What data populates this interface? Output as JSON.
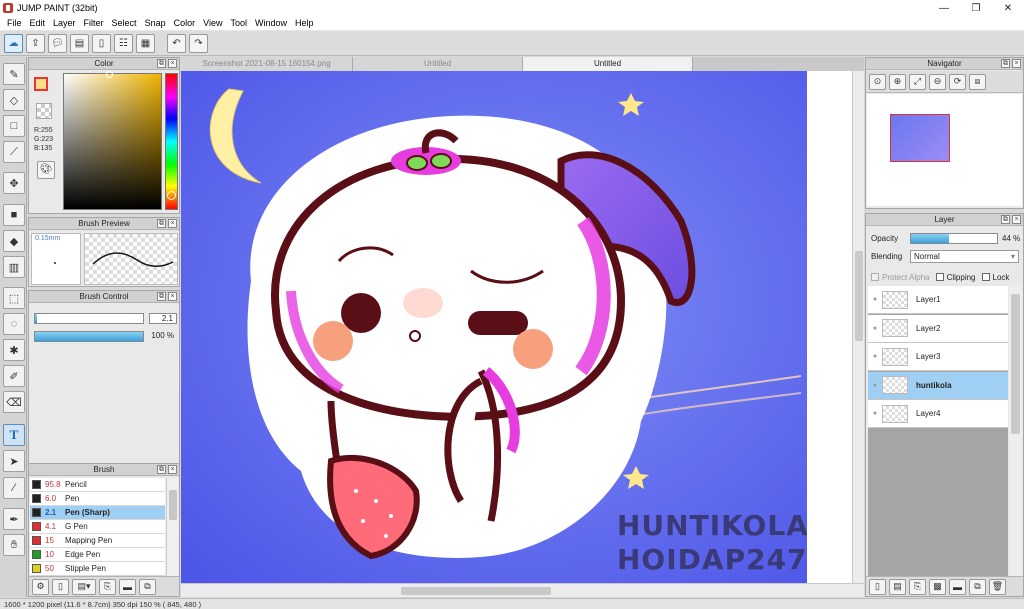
{
  "window": {
    "title": "JUMP PAINT (32bit)",
    "controls": [
      "—",
      "❐",
      "✕"
    ]
  },
  "menu": [
    "File",
    "Edit",
    "Layer",
    "Filter",
    "Select",
    "Snap",
    "Color",
    "View",
    "Tool",
    "Window",
    "Help"
  ],
  "toolbar": {
    "icons": [
      "cloud-upload-icon",
      "share-icon",
      "comment-icon",
      "chat-icon",
      "document-icon",
      "grid-list-icon",
      "template-icon",
      "undo-icon",
      "redo-icon"
    ]
  },
  "tools": [
    "pen-icon",
    "eraser-icon",
    "rectangle-select-icon",
    "line-icon",
    "move-icon",
    "fill-square-icon",
    "bucket-icon",
    "gradient-icon",
    "marquee-icon",
    "lasso-icon",
    "magic-wand-icon",
    "select-pen-icon",
    "select-eraser-icon",
    "text-icon",
    "operation-icon",
    "eyedropper-alt-icon",
    "eyedropper-icon",
    "hand-icon"
  ],
  "text_tool_label": "T",
  "color_panel": {
    "title": "Color",
    "rgb": [
      "R:255",
      "G:223",
      "B:135"
    ],
    "fg_color": "#ffdf87",
    "bg_color": "#ff7ac8"
  },
  "brush_preview": {
    "title": "Brush Preview",
    "size_label": "0.15mm"
  },
  "brush_control": {
    "title": "Brush Control",
    "size_value": "2.1",
    "opacity_value": "100 %",
    "size_fraction": 0.02,
    "opacity_fraction": 1.0
  },
  "brush_panel": {
    "title": "Brush",
    "items": [
      {
        "size": "95.8",
        "name": "Pencil",
        "color": "#222222"
      },
      {
        "size": "6.0",
        "name": "Pen",
        "color": "#222222"
      },
      {
        "size": "2.1",
        "name": "Pen (Sharp)",
        "color": "#222222",
        "selected": true
      },
      {
        "size": "4.1",
        "name": "G Pen",
        "color": "#e03030"
      },
      {
        "size": "15",
        "name": "Mapping Pen",
        "color": "#e03030"
      },
      {
        "size": "10",
        "name": "Edge Pen",
        "color": "#20a020"
      },
      {
        "size": "50",
        "name": "Stipple Pen",
        "color": "#e0d020"
      }
    ]
  },
  "document": {
    "tabs": [
      "Screenshot 2021-08-15 160154.png",
      "Untitled",
      "Untitled"
    ],
    "active_tab": 2,
    "watermark": [
      "HUNTIKOLA",
      "HOIDAP247"
    ]
  },
  "navigator": {
    "title": "Navigator"
  },
  "layer_panel": {
    "title": "Layer",
    "opacity_label": "Opacity",
    "opacity_value": "44 %",
    "opacity_fraction": 0.44,
    "blending_label": "Blending",
    "blending_value": "Normal",
    "protect_alpha": "Protect Alpha",
    "clipping": "Clipping",
    "lock": "Lock",
    "layers": [
      {
        "name": "Layer1"
      },
      {
        "name": "Layer2"
      },
      {
        "name": "Layer3"
      },
      {
        "name": "huntikola",
        "selected": true
      },
      {
        "name": "Layer4"
      }
    ]
  },
  "status": "1600 * 1200 pixel   (11.6 * 8.7cm)   350 dpi   150 %   ( 845, 480 )"
}
